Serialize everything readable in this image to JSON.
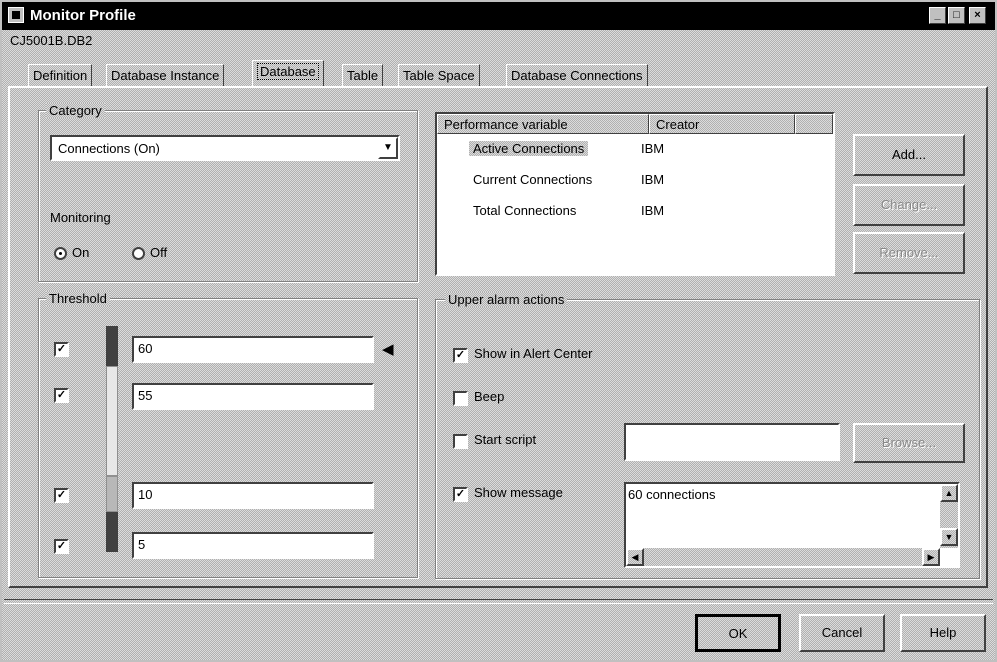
{
  "window": {
    "title": "Monitor Profile",
    "db_name": "CJ5001B.DB2"
  },
  "tabs": [
    {
      "label": "Definition"
    },
    {
      "label": "Database Instance"
    },
    {
      "label": "Database",
      "active": true
    },
    {
      "label": "Table"
    },
    {
      "label": "Table Space"
    },
    {
      "label": "Database Connections"
    }
  ],
  "category": {
    "label": "Category",
    "value": "Connections (On)"
  },
  "monitoring": {
    "label": "Monitoring",
    "on_label": "On",
    "off_label": "Off",
    "selected": "On"
  },
  "threshold": {
    "label": "Threshold",
    "values": [
      "60",
      "55",
      "10",
      "5"
    ]
  },
  "perf_list": {
    "columns": [
      "Performance variable",
      "Creator"
    ],
    "rows": [
      {
        "variable": "Active Connections",
        "creator": "IBM",
        "selected": true
      },
      {
        "variable": "Current Connections",
        "creator": "IBM"
      },
      {
        "variable": "Total Connections",
        "creator": "IBM"
      }
    ]
  },
  "side_buttons": {
    "add": "Add...",
    "change": "Change...",
    "remove": "Remove..."
  },
  "alarm": {
    "label": "Upper alarm actions",
    "show_alert": "Show in Alert Center",
    "beep": "Beep",
    "start_script": "Start script",
    "browse": "Browse...",
    "show_message": "Show message",
    "message_text": "60 connections"
  },
  "footer": {
    "ok": "OK",
    "cancel": "Cancel",
    "help": "Help"
  }
}
